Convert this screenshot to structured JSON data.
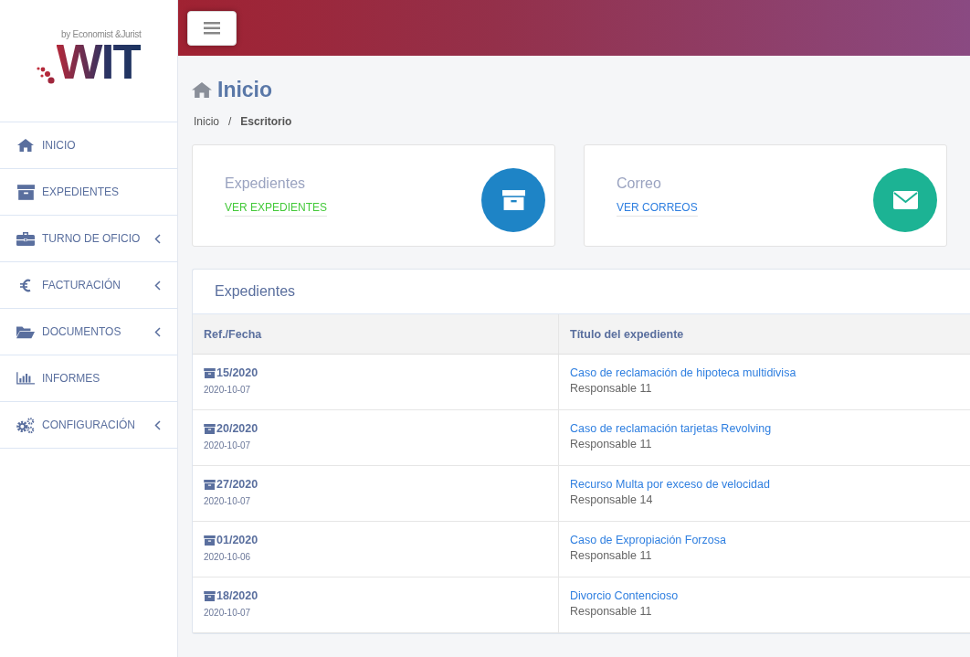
{
  "logo": {
    "tagline": "by Economist &Jurist",
    "wordmark": "WIT"
  },
  "sidebar": {
    "items": [
      {
        "label": "INICIO",
        "has_submenu": false
      },
      {
        "label": "EXPEDIENTES",
        "has_submenu": false
      },
      {
        "label": "TURNO DE OFICIO",
        "has_submenu": true
      },
      {
        "label": "FACTURACIÓN",
        "has_submenu": true
      },
      {
        "label": "DOCUMENTOS",
        "has_submenu": true
      },
      {
        "label": "INFORMES",
        "has_submenu": false
      },
      {
        "label": "CONFIGURACIÓN",
        "has_submenu": true
      }
    ]
  },
  "page": {
    "title": "Inicio",
    "breadcrumb": [
      "Inicio",
      "Escritorio"
    ],
    "breadcrumb_separator": "/"
  },
  "cards": [
    {
      "kind": "cases",
      "title": "Expedientes",
      "link": "VER EXPEDIENTES",
      "color": "#1e84c6"
    },
    {
      "kind": "mail",
      "title": "Correo",
      "link": "VER CORREOS",
      "color": "#1cb394"
    }
  ],
  "table": {
    "title": "Expedientes",
    "columns": [
      "Ref./Fecha",
      "Título del expediente"
    ],
    "rows": [
      {
        "ref": "15/2020",
        "date": "2020-10-07",
        "title": "Caso de reclamación de hipoteca multidivisa",
        "owner": "Responsable 11"
      },
      {
        "ref": "20/2020",
        "date": "2020-10-07",
        "title": "Caso de reclamación tarjetas Revolving",
        "owner": "Responsable 11"
      },
      {
        "ref": "27/2020",
        "date": "2020-10-07",
        "title": "Recurso Multa por exceso de velocidad",
        "owner": "Responsable 14"
      },
      {
        "ref": "01/2020",
        "date": "2020-10-06",
        "title": "Caso de Expropiación Forzosa",
        "owner": "Responsable 11"
      },
      {
        "ref": "18/2020",
        "date": "2020-10-07",
        "title": "Divorcio Contencioso",
        "owner": "Responsable 11"
      }
    ]
  }
}
